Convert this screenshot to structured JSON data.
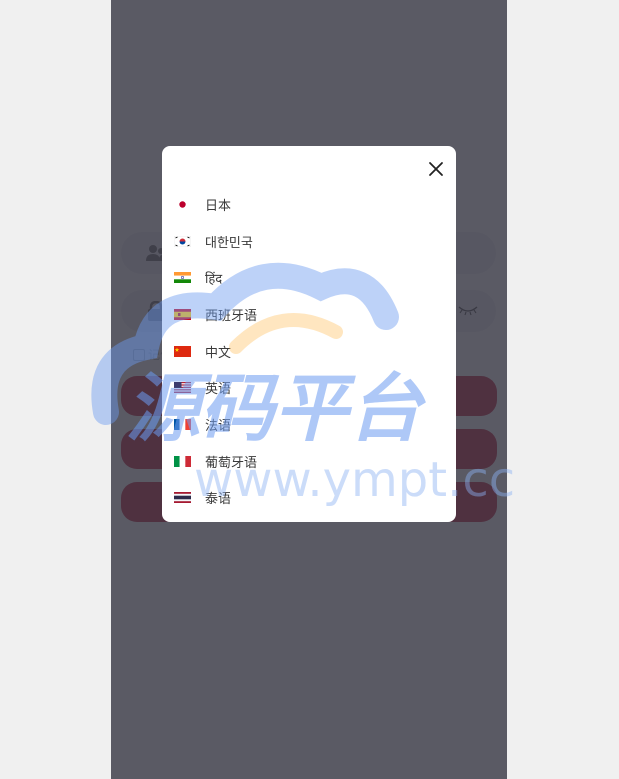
{
  "login": {
    "remember_label": "记住"
  },
  "modal": {
    "languages": [
      {
        "label": "日本",
        "flag": "jp-flag-icon"
      },
      {
        "label": "대한민국",
        "flag": "kr-flag-icon"
      },
      {
        "label": "हिंद",
        "flag": "in-flag-icon"
      },
      {
        "label": "西班牙语",
        "flag": "es-flag-icon"
      },
      {
        "label": "中文",
        "flag": "cn-flag-icon"
      },
      {
        "label": "英语",
        "flag": "us-flag-icon"
      },
      {
        "label": "法语",
        "flag": "fr-flag-icon"
      },
      {
        "label": "葡萄牙语",
        "flag": "pt-flag-icon"
      },
      {
        "label": "泰语",
        "flag": "th-flag-icon"
      }
    ]
  },
  "watermark": {
    "text": "源码平台",
    "url": "www.ympt.cc"
  },
  "colors": {
    "primary_button": "#b70024",
    "overlay": "#3a3a46",
    "watermark_blue": "#6c9bf0",
    "watermark_orange": "#ffb64a"
  }
}
